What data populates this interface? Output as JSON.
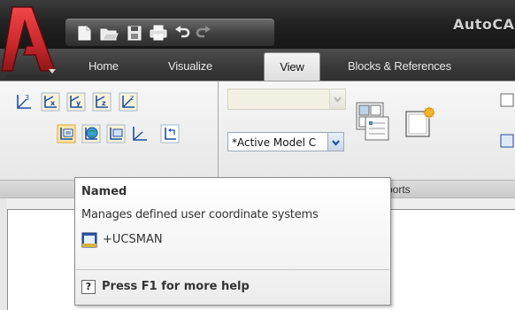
{
  "window": {
    "app_title": "AutoCAD"
  },
  "quick_access_toolbar": {
    "icons": [
      "new-icon",
      "open-icon",
      "save-icon",
      "plot-icon",
      "undo-icon",
      "redo-icon"
    ]
  },
  "ribbon": {
    "tabs": [
      {
        "label": "Home",
        "active": false
      },
      {
        "label": "Visualize",
        "active": false
      },
      {
        "label": "View",
        "active": true
      },
      {
        "label": "Blocks & References",
        "active": false
      }
    ],
    "panels": {
      "ucs": {
        "row1_icons": [
          "ucs-3point-icon",
          "ucs-x-icon",
          "ucs-y-icon",
          "ucs-z-icon",
          "ucs-zaxis-icon"
        ],
        "row2_icons": [
          "ucs-named-icon",
          "ucs-world-icon",
          "ucs-face-icon",
          "ucs-view-icon",
          "ucs-previous-icon"
        ]
      },
      "viewports": {
        "title_partial": "ports",
        "view_combo_value": "",
        "model_combo_value": "*Active Model C",
        "icons": [
          "viewport-configuration-icon",
          "new-viewport-icon"
        ]
      }
    }
  },
  "tooltip": {
    "title": "Named",
    "description": "Manages defined user coordinate systems",
    "command": "+UCSMAN",
    "help_icon": "?",
    "help_text": "Press F1 for more help"
  },
  "colors": {
    "app_button_red": "#c8272b",
    "title_bar": "#232323",
    "ribbon_bg": "#eeeeee",
    "ucs_icon_blue": "#1c4fa0"
  }
}
